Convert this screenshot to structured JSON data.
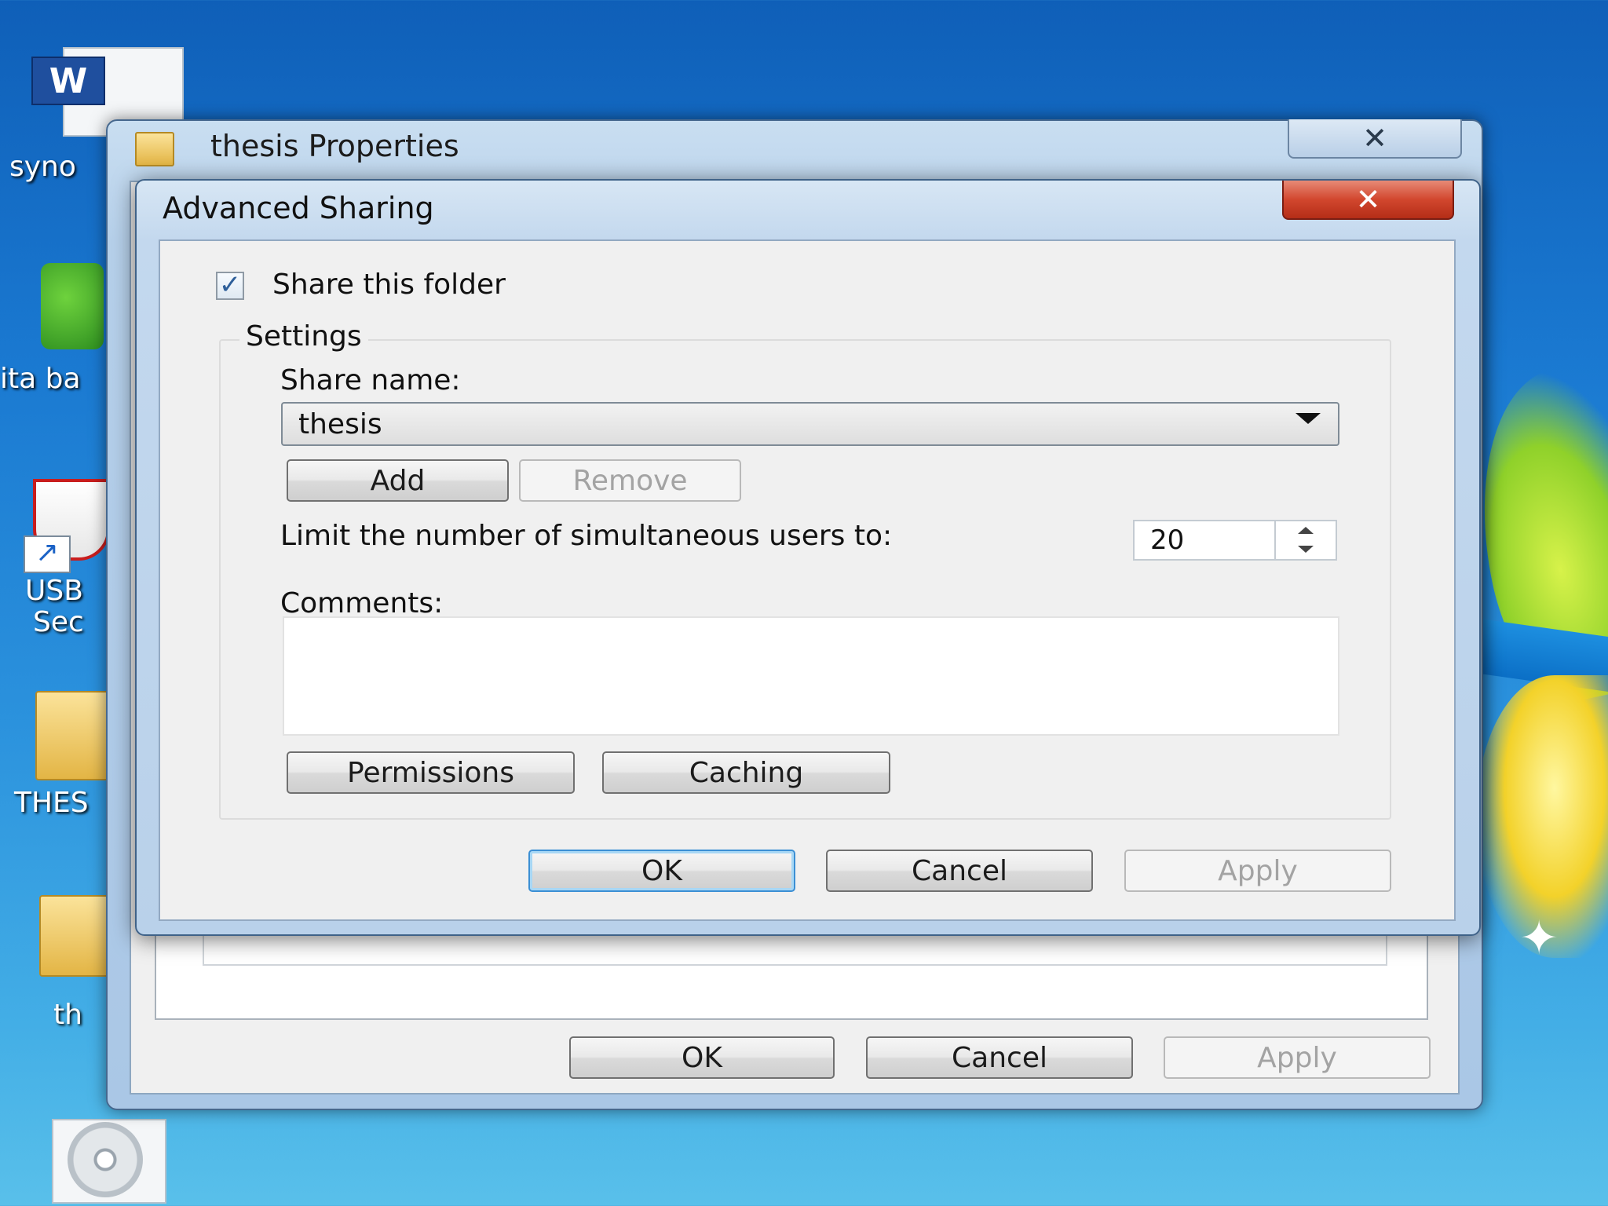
{
  "desktop": {
    "icons": [
      {
        "label": "syno"
      },
      {
        "label": "ita ba"
      },
      {
        "label": "USB"
      },
      {
        "label": "Sec"
      },
      {
        "label": "THES"
      },
      {
        "label": "th"
      }
    ]
  },
  "properties_window": {
    "title": "thesis Properties",
    "close_label": "✕",
    "ok_label": "OK",
    "cancel_label": "Cancel",
    "apply_label": "Apply"
  },
  "advanced_sharing": {
    "title": "Advanced Sharing",
    "close_label": "✕",
    "share_checkbox_label": "Share this folder",
    "share_checked": true,
    "settings_label": "Settings",
    "share_name_label": "Share name:",
    "share_name_value": "thesis",
    "add_label": "Add",
    "remove_label": "Remove",
    "limit_label": "Limit the number of simultaneous users to:",
    "limit_value": "20",
    "comments_label": "Comments:",
    "comments_value": "",
    "permissions_label": "Permissions",
    "caching_label": "Caching",
    "ok_label": "OK",
    "cancel_label": "Cancel",
    "apply_label": "Apply"
  },
  "icons": {
    "checkmark": "✓",
    "folder": "folder-icon",
    "word": "W"
  }
}
